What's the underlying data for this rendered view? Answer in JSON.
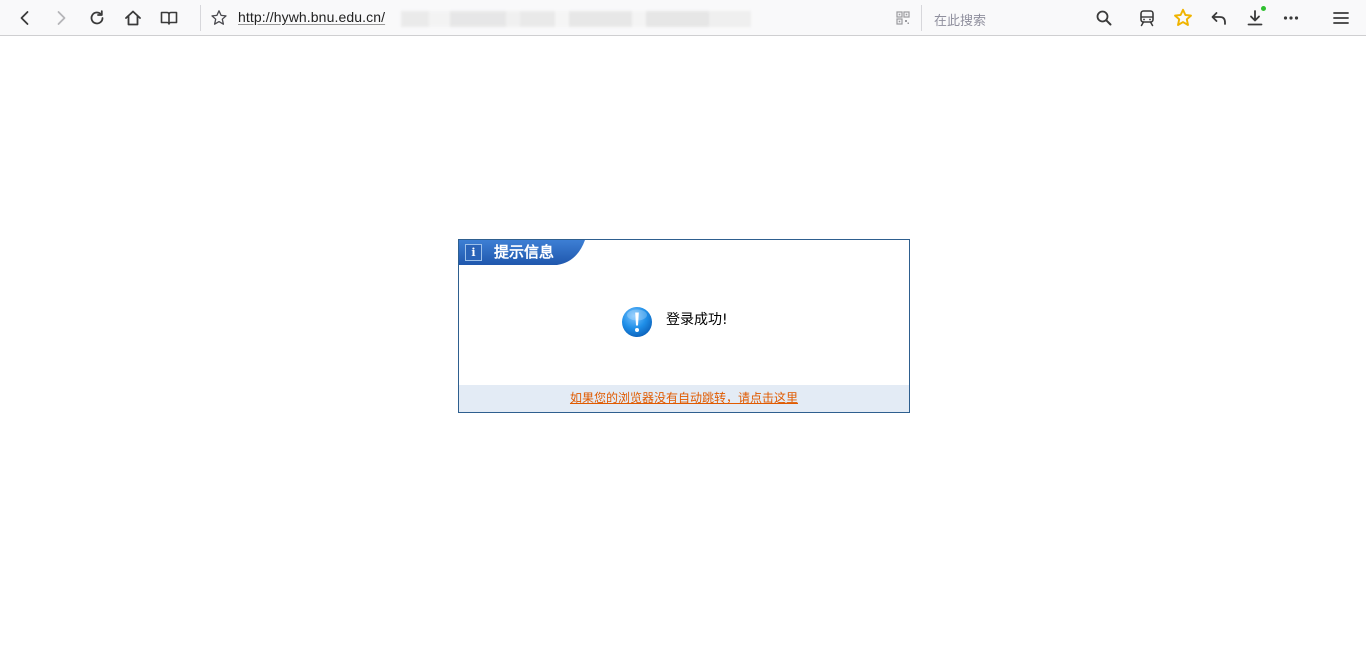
{
  "browser": {
    "url": "http://hywh.bnu.edu.cn/",
    "search_placeholder": "在此搜索",
    "icons": {
      "back": "back-arrow-icon",
      "forward": "forward-arrow-icon",
      "reload": "reload-icon",
      "home": "home-icon",
      "reader": "reader-view-icon",
      "bookmark": "bookmark-star-icon",
      "qr": "qr-code-icon",
      "search": "search-icon",
      "train": "train-icon",
      "favorites": "favorites-star-icon",
      "undo": "undo-icon",
      "download": "download-icon",
      "more": "more-icon",
      "menu": "menu-icon"
    },
    "download_indicator_color": "#30c030",
    "favorites_color": "#f0b400"
  },
  "dialog": {
    "title": "提示信息",
    "message": "登录成功!",
    "footer_link": "如果您的浏览器没有自动跳转，请点击这里",
    "colors": {
      "header": "#2a63b8",
      "border": "#2e5f8f",
      "footer_bg": "#e3ebf5",
      "link": "#e05a00"
    }
  }
}
